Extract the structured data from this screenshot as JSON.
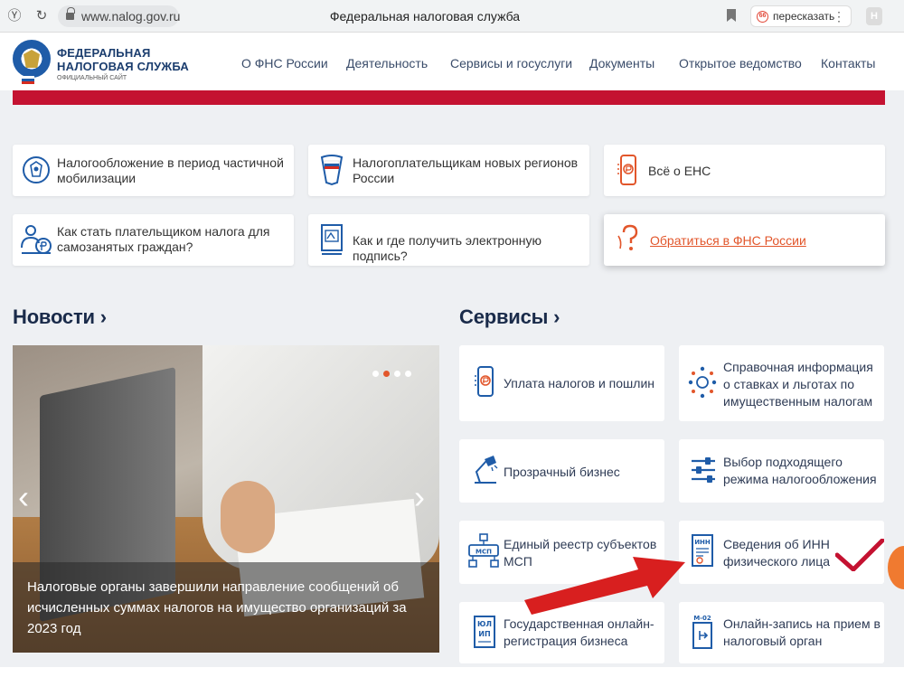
{
  "browser": {
    "url": "www.nalog.gov.ru",
    "title": "Федеральная налоговая служба",
    "retell_label": "пересказать",
    "retell_badge": "66",
    "profile_letter": "Н"
  },
  "header": {
    "logo_line1": "ФЕДЕРАЛЬНАЯ",
    "logo_line2": "НАЛОГОВАЯ СЛУЖБА",
    "logo_sub": "ОФИЦИАЛЬНЫЙ САЙТ",
    "nav": [
      "О ФНС России",
      "Деятельность",
      "Сервисы и госуслуги",
      "Документы",
      "Открытое ведомство",
      "Контакты"
    ]
  },
  "quick_links": [
    {
      "label": "Налогообложение в период частичной мобилизации",
      "icon": "emblem-icon"
    },
    {
      "label": "Налогоплательщикам новых регионов России",
      "icon": "flag-shield-icon"
    },
    {
      "label": "Всё о ЕНС",
      "icon": "phone-ruble-icon"
    },
    {
      "label": "Как стать плательщиком налога для самозанятых граждан?",
      "icon": "person-ruble-icon"
    },
    {
      "label": "Как и где получить электронную подпись?",
      "icon": "document-signature-icon"
    },
    {
      "label": "Обратиться в ФНС России",
      "icon": "question-icon"
    }
  ],
  "news": {
    "title": "Новости",
    "caption": "Налоговые органы завершили направление сообщений об исчисленных суммах налогов на имущество организаций за 2023 год",
    "slide_count": 4,
    "active_slide": 2
  },
  "services": {
    "title": "Сервисы",
    "items": [
      {
        "label": "Уплата налогов и пошлин",
        "icon": "phone-ruble-icon"
      },
      {
        "label": "Справочная информация о ставках и льготах по имущественным налогам",
        "icon": "emblem-dots-icon"
      },
      {
        "label": "Прозрачный бизнес",
        "icon": "lamp-icon"
      },
      {
        "label": "Выбор подходящего режима налогообложения",
        "icon": "sliders-icon"
      },
      {
        "label": "Единый реестр субъектов МСП",
        "icon": "msp-network-icon"
      },
      {
        "label": "Сведения об ИНН физического лица",
        "icon": "inn-document-icon"
      },
      {
        "label": "Государственная онлайн-регистрация бизнеса",
        "icon": "ul-ip-document-icon"
      },
      {
        "label": "Онлайн-запись на прием в налоговый орган",
        "icon": "m02-document-icon"
      }
    ]
  },
  "icon_texts": {
    "msp": "МСП",
    "inn": "ИНН",
    "ul": "ЮЛ",
    "ip": "ИП",
    "m02": "М-02"
  },
  "colors": {
    "accent_red": "#c41231",
    "link_orange": "#e2562b",
    "brand_blue": "#1f5ca8",
    "annotation_red": "#d81f1f"
  }
}
